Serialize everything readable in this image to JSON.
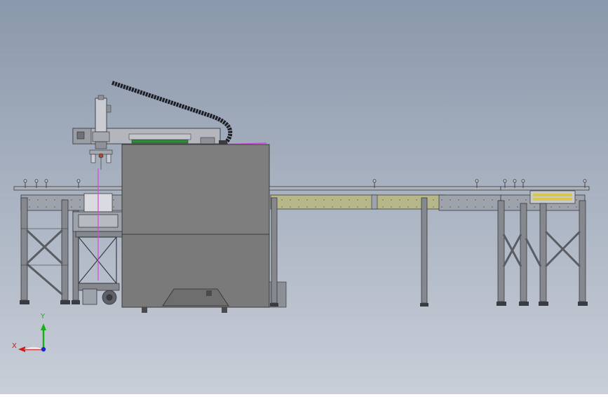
{
  "viewport": {
    "background_top": "#8a98ab",
    "background_bottom": "#c9ced8"
  },
  "colors": {
    "frame": "#7d8088",
    "frame_dark": "#2b2d33",
    "frame_light": "#aeb2ba",
    "cabinet": "#7e7e7e",
    "cabinet_edge": "#3c3c3c",
    "conveyor_panel": "#b7b88a",
    "roller_yellow": "#d8c94a",
    "accent_green": "#2f8a3a",
    "accent_magenta": "#d04ad8",
    "cable_chain": "#1e1f26"
  },
  "triad": {
    "x_label": "X",
    "y_label": "Y",
    "x_color": "#d01818",
    "y_color": "#18b018",
    "z_color": "#1828d0"
  },
  "icons": {
    "axis_triad": "axis-triad-icon"
  }
}
